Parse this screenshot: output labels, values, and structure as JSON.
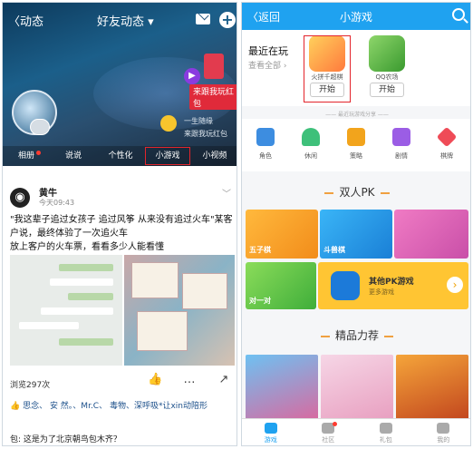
{
  "left": {
    "header": {
      "back": "〈动态",
      "title": "好友动态"
    },
    "red_tag": "来跟我玩红包",
    "user_line1": "一生随缘",
    "user_line2": "来跟我玩红包",
    "tabs": [
      {
        "label": "相册"
      },
      {
        "label": "说说"
      },
      {
        "label": "个性化"
      },
      {
        "label": "小游戏"
      },
      {
        "label": "小视频"
      }
    ],
    "post": {
      "author": "黄牛",
      "time": "今天09:43",
      "text": "\"我这辈子追过女孩子 追过风筝 从来没有追过火车\"某客户说，最终体验了一次追火车\n    放上客户的火车票，看看多少人能看懂",
      "reads": "浏览297次",
      "likes_names": "思念、 安 然。、Mr.C、 毒物、深呼吸*让xin动陪形",
      "comment": "包: 这是为了北京朝鸟包木齐？"
    }
  },
  "right": {
    "header": {
      "back": "〈返回",
      "title": "小游戏"
    },
    "recent": {
      "title": "最近在玩",
      "view_all": "查看全部",
      "games": [
        {
          "name": "火拼千超棋",
          "button": "开始"
        },
        {
          "name": "QQ农场",
          "button": "开始"
        }
      ]
    },
    "divider": "—— 最近玩游戏分享 ——",
    "categories": [
      {
        "label": "角色",
        "color": "#3d8de0"
      },
      {
        "label": "休闲",
        "color": "#3ec07a"
      },
      {
        "label": "策略",
        "color": "#f2a41c"
      },
      {
        "label": "剧情",
        "color": "#9b5de5"
      },
      {
        "label": "棋牌",
        "color": "#ef4b57"
      }
    ],
    "pk_title": "双人PK",
    "pk_games": [
      {
        "label": "五子棋"
      },
      {
        "label": "斗兽棋"
      },
      {
        "label": ""
      },
      {
        "label": "对一对"
      }
    ],
    "other": {
      "title": "其他PK游戏",
      "subtitle": "更多游戏"
    },
    "featured_title": "精品力荐",
    "bottom_tabs": [
      {
        "label": "游戏",
        "active": true
      },
      {
        "label": "社区"
      },
      {
        "label": "礼包"
      },
      {
        "label": "我的"
      }
    ]
  }
}
